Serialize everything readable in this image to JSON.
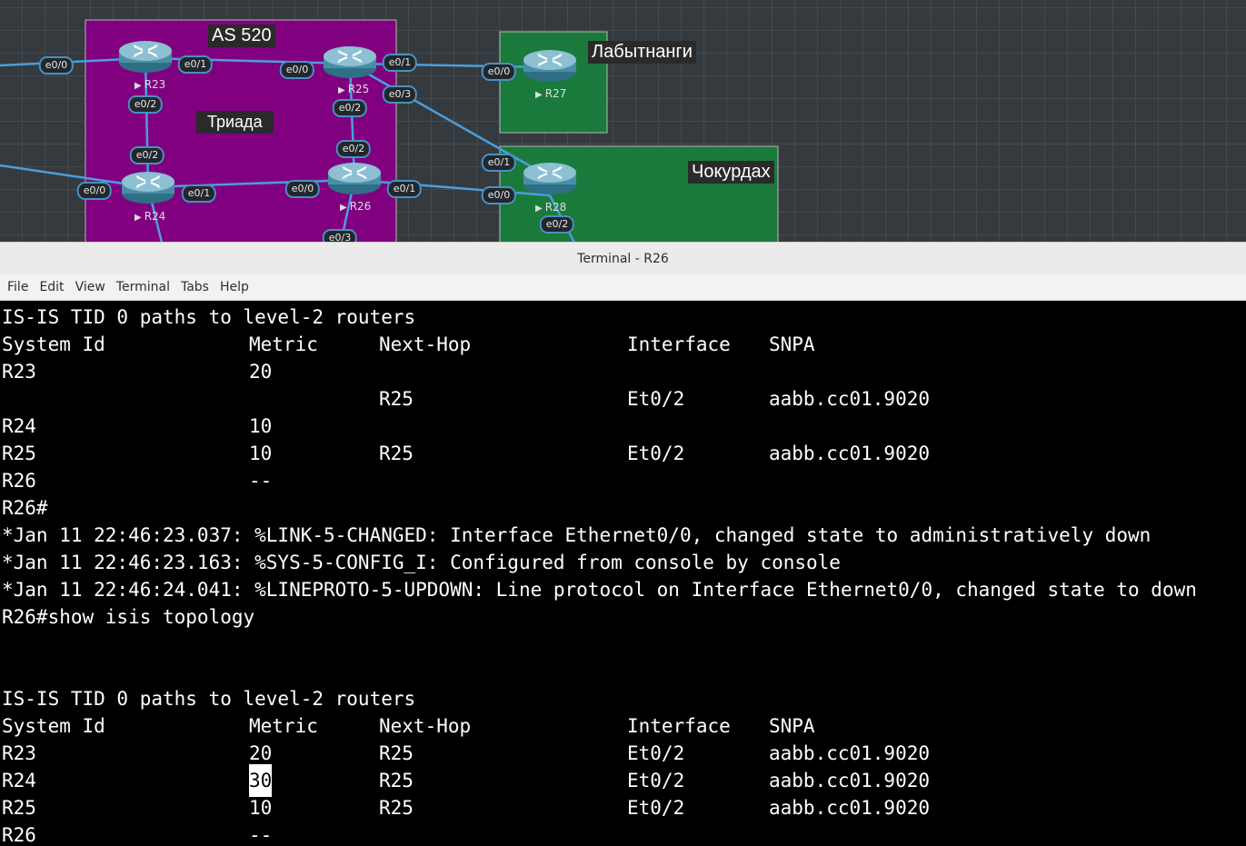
{
  "topology": {
    "zones": {
      "as520": "AS 520",
      "triada": "Триада",
      "labytnangi": "Лабытнанги",
      "chokurdakh": "Чокурдах"
    },
    "routers": [
      {
        "id": "r23",
        "name": "R23"
      },
      {
        "id": "r25",
        "name": "R25"
      },
      {
        "id": "r27",
        "name": "R27"
      },
      {
        "id": "r24",
        "name": "R24"
      },
      {
        "id": "r26",
        "name": "R26"
      },
      {
        "id": "r28",
        "name": "R28"
      }
    ],
    "interfaces": [
      "e0/0",
      "e0/1",
      "e0/0",
      "e0/1",
      "e0/0",
      "e0/3",
      "e0/2",
      "e0/2",
      "e0/2",
      "e0/2",
      "e0/0",
      "e0/1",
      "e0/0",
      "e0/1",
      "e0/1",
      "e0/0",
      "e0/2",
      "e0/3"
    ],
    "colors": {
      "zone_as520": "#800080",
      "zone_green": "#1a7a3c",
      "link": "#4a9fde"
    }
  },
  "window": {
    "title": "Terminal - R26"
  },
  "menu": [
    "File",
    "Edit",
    "View",
    "Terminal",
    "Tabs",
    "Help"
  ],
  "terminal": {
    "block1": {
      "heading": "IS-IS TID 0 paths to level-2 routers",
      "headers": [
        "System Id",
        "Metric",
        "Next-Hop",
        "Interface",
        "SNPA"
      ],
      "rows": [
        [
          "R23",
          "20",
          "",
          "",
          ""
        ],
        [
          "",
          "",
          "R25",
          "Et0/2",
          "aabb.cc01.9020"
        ],
        [
          "R24",
          "10",
          "",
          "",
          ""
        ],
        [
          "R25",
          "10",
          "R25",
          "Et0/2",
          "aabb.cc01.9020"
        ],
        [
          "R26",
          "--",
          "",
          "",
          ""
        ]
      ]
    },
    "prompt1": "R26#",
    "logs": [
      "*Jan 11 22:46:23.037: %LINK-5-CHANGED: Interface Ethernet0/0, changed state to administratively down",
      "*Jan 11 22:46:23.163: %SYS-5-CONFIG_I: Configured from console by console",
      "*Jan 11 22:46:24.041: %LINEPROTO-5-UPDOWN: Line protocol on Interface Ethernet0/0, changed state to down"
    ],
    "command": "R26#show isis topology",
    "block2": {
      "heading": "IS-IS TID 0 paths to level-2 routers",
      "headers": [
        "System Id",
        "Metric",
        "Next-Hop",
        "Interface",
        "SNPA"
      ],
      "rows": [
        [
          "R23",
          "20",
          "R25",
          "Et0/2",
          "aabb.cc01.9020"
        ],
        [
          "R24",
          "30",
          "R25",
          "Et0/2",
          "aabb.cc01.9020"
        ],
        [
          "R25",
          "10",
          "R25",
          "Et0/2",
          "aabb.cc01.9020"
        ],
        [
          "R26",
          "--",
          "",
          "",
          ""
        ]
      ]
    }
  }
}
